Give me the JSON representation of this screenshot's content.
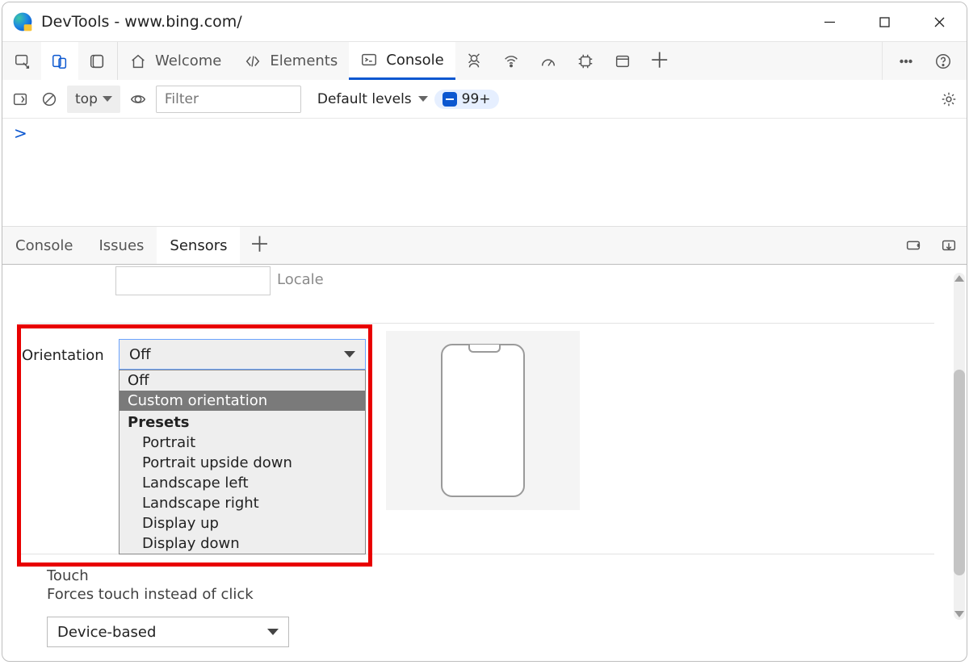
{
  "window": {
    "title": "DevTools - www.bing.com/"
  },
  "tabs": {
    "welcome": "Welcome",
    "elements": "Elements",
    "console": "Console"
  },
  "filterbar": {
    "context": "top",
    "filter_placeholder": "Filter",
    "levels": "Default levels",
    "issue_count": "99+"
  },
  "console": {
    "prompt": ">"
  },
  "drawer": {
    "tabs": {
      "console": "Console",
      "issues": "Issues",
      "sensors": "Sensors"
    }
  },
  "sensors": {
    "locale_label": "Locale",
    "orientation_label": "Orientation",
    "orientation_value": "Off",
    "orientation_options": {
      "off": "Off",
      "custom": "Custom orientation",
      "group": "Presets",
      "portrait": "Portrait",
      "portrait_upside": "Portrait upside down",
      "landscape_left": "Landscape left",
      "landscape_right": "Landscape right",
      "display_up": "Display up",
      "display_down": "Display down"
    },
    "touch_label": "Touch",
    "touch_desc": "Forces touch instead of click",
    "touch_value": "Device-based"
  }
}
